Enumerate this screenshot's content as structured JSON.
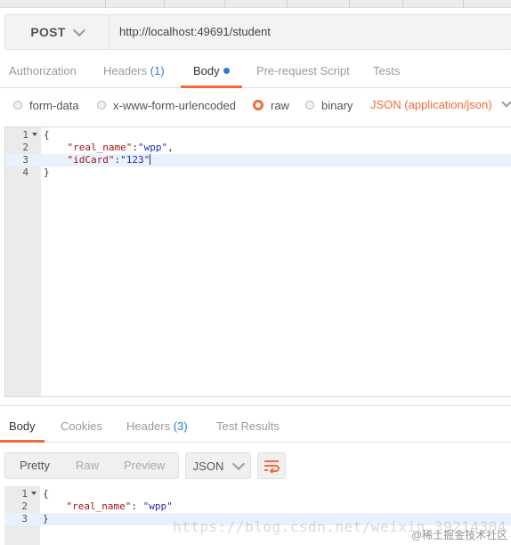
{
  "request": {
    "method": "POST",
    "url": "http://localhost:49691/student"
  },
  "request_tabs": [
    {
      "label": "Authorization",
      "count": ""
    },
    {
      "label": "Headers",
      "count": "(1)"
    },
    {
      "label": "Body",
      "count": ""
    },
    {
      "label": "Pre-request Script",
      "count": ""
    },
    {
      "label": "Tests",
      "count": ""
    }
  ],
  "body_modes": {
    "form_data": "form-data",
    "urlencoded": "x-www-form-urlencoded",
    "raw": "raw",
    "binary": "binary",
    "content_type": "JSON (application/json)"
  },
  "request_body": {
    "line_numbers": [
      "1",
      "2",
      "3",
      "4"
    ],
    "l1": "{",
    "l2_key": "\"real_name\"",
    "l2_sep": ":",
    "l2_val": "\"wpp\"",
    "l2_end": ",",
    "l3_key": "\"idCard\"",
    "l3_sep": ":",
    "l3_val": "\"123\"",
    "l4": "}"
  },
  "response_tabs": [
    {
      "label": "Body",
      "count": ""
    },
    {
      "label": "Cookies",
      "count": ""
    },
    {
      "label": "Headers",
      "count": "(3)"
    },
    {
      "label": "Test Results",
      "count": ""
    }
  ],
  "response_view": {
    "pretty": "Pretty",
    "raw": "Raw",
    "preview": "Preview",
    "format": "JSON"
  },
  "response_body": {
    "line_numbers": [
      "1",
      "2",
      "3"
    ],
    "l1": "{",
    "l2_key": "\"real_name\"",
    "l2_sep": ": ",
    "l2_val": "\"wpp\"",
    "l3": "}"
  },
  "watermark": {
    "url": "https://blog.csdn.net/weixin_39214304",
    "credit": "@稀土掘金技术社区"
  },
  "colors": {
    "accent": "#f26b3a",
    "link": "#2f7bd1",
    "json_key": "#a31515",
    "json_string": "#2a2ab5"
  }
}
